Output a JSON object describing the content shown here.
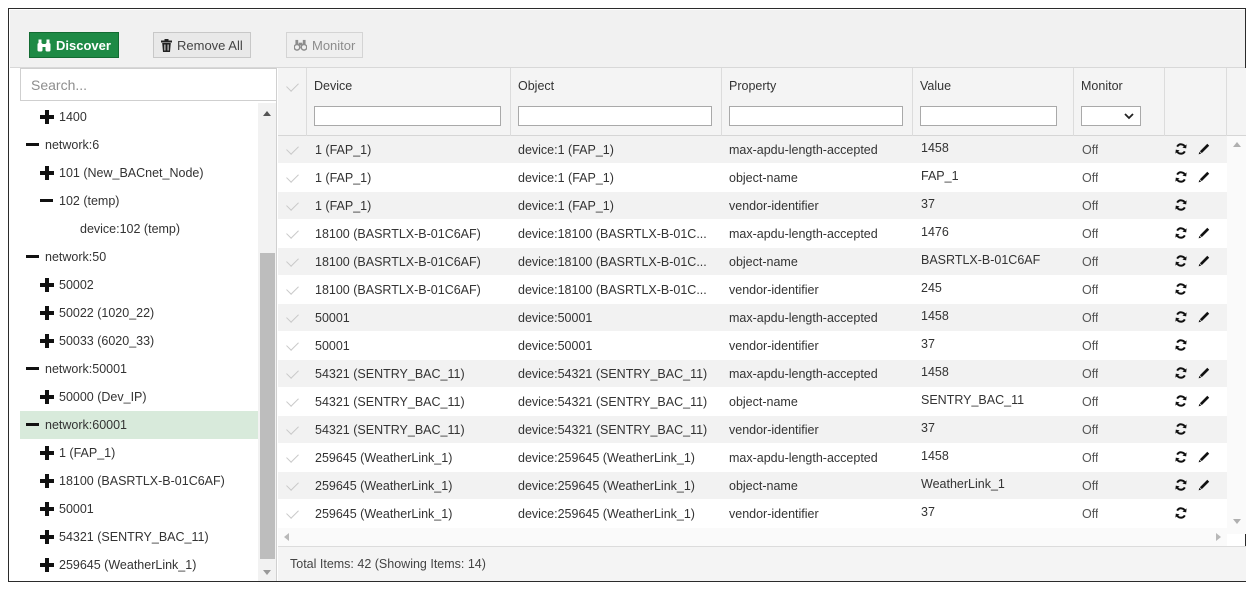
{
  "toolbar": {
    "discover_label": "Discover",
    "remove_all_label": "Remove All",
    "monitor_label": "Monitor",
    "discover_color": "#1e8a45"
  },
  "tree": {
    "search_placeholder": "Search...",
    "items": [
      {
        "label": "1400",
        "icon": "plus",
        "indent": 1
      },
      {
        "label": "network:6",
        "icon": "minus",
        "indent": 0
      },
      {
        "label": "101 (New_BACnet_Node)",
        "icon": "plus",
        "indent": 1
      },
      {
        "label": "102 (temp)",
        "icon": "minus",
        "indent": 1
      },
      {
        "label": "device:102 (temp)",
        "icon": "none",
        "indent": 2
      },
      {
        "label": "network:50",
        "icon": "minus",
        "indent": 0
      },
      {
        "label": "50002",
        "icon": "plus",
        "indent": 1
      },
      {
        "label": "50022 (1020_22)",
        "icon": "plus",
        "indent": 1
      },
      {
        "label": "50033 (6020_33)",
        "icon": "plus",
        "indent": 1
      },
      {
        "label": "network:50001",
        "icon": "minus",
        "indent": 0
      },
      {
        "label": "50000 (Dev_IP)",
        "icon": "plus",
        "indent": 1
      },
      {
        "label": "network:60001",
        "icon": "minus",
        "indent": 0,
        "selected": true
      },
      {
        "label": "1 (FAP_1)",
        "icon": "plus",
        "indent": 1
      },
      {
        "label": "18100 (BASRTLX-B-01C6AF)",
        "icon": "plus",
        "indent": 1
      },
      {
        "label": "50001",
        "icon": "plus",
        "indent": 1
      },
      {
        "label": "54321 (SENTRY_BAC_11)",
        "icon": "plus",
        "indent": 1
      },
      {
        "label": "259645 (WeatherLink_1)",
        "icon": "plus",
        "indent": 1
      }
    ]
  },
  "grid": {
    "columns": {
      "device": "Device",
      "object": "Object",
      "property": "Property",
      "value": "Value",
      "monitor": "Monitor"
    },
    "rows": [
      {
        "device": "1 (FAP_1)",
        "object": "device:1 (FAP_1)",
        "property": "max-apdu-length-accepted",
        "value": "1458",
        "monitor": "Off",
        "editable": true
      },
      {
        "device": "1 (FAP_1)",
        "object": "device:1 (FAP_1)",
        "property": "object-name",
        "value": "FAP_1",
        "monitor": "Off",
        "editable": true
      },
      {
        "device": "1 (FAP_1)",
        "object": "device:1 (FAP_1)",
        "property": "vendor-identifier",
        "value": "37",
        "monitor": "Off",
        "editable": false
      },
      {
        "device": "18100 (BASRTLX-B-01C6AF)",
        "object": "device:18100 (BASRTLX-B-01C...",
        "property": "max-apdu-length-accepted",
        "value": "1476",
        "monitor": "Off",
        "editable": true
      },
      {
        "device": "18100 (BASRTLX-B-01C6AF)",
        "object": "device:18100 (BASRTLX-B-01C...",
        "property": "object-name",
        "value": "BASRTLX-B-01C6AF",
        "monitor": "Off",
        "editable": true
      },
      {
        "device": "18100 (BASRTLX-B-01C6AF)",
        "object": "device:18100 (BASRTLX-B-01C...",
        "property": "vendor-identifier",
        "value": "245",
        "monitor": "Off",
        "editable": false
      },
      {
        "device": "50001",
        "object": "device:50001",
        "property": "max-apdu-length-accepted",
        "value": "1458",
        "monitor": "Off",
        "editable": true
      },
      {
        "device": "50001",
        "object": "device:50001",
        "property": "vendor-identifier",
        "value": "37",
        "monitor": "Off",
        "editable": false
      },
      {
        "device": "54321 (SENTRY_BAC_11)",
        "object": "device:54321 (SENTRY_BAC_11)",
        "property": "max-apdu-length-accepted",
        "value": "1458",
        "monitor": "Off",
        "editable": true
      },
      {
        "device": "54321 (SENTRY_BAC_11)",
        "object": "device:54321 (SENTRY_BAC_11)",
        "property": "object-name",
        "value": "SENTRY_BAC_11",
        "monitor": "Off",
        "editable": true
      },
      {
        "device": "54321 (SENTRY_BAC_11)",
        "object": "device:54321 (SENTRY_BAC_11)",
        "property": "vendor-identifier",
        "value": "37",
        "monitor": "Off",
        "editable": false
      },
      {
        "device": "259645 (WeatherLink_1)",
        "object": "device:259645 (WeatherLink_1)",
        "property": "max-apdu-length-accepted",
        "value": "1458",
        "monitor": "Off",
        "editable": true
      },
      {
        "device": "259645 (WeatherLink_1)",
        "object": "device:259645 (WeatherLink_1)",
        "property": "object-name",
        "value": "WeatherLink_1",
        "monitor": "Off",
        "editable": true
      },
      {
        "device": "259645 (WeatherLink_1)",
        "object": "device:259645 (WeatherLink_1)",
        "property": "vendor-identifier",
        "value": "37",
        "monitor": "Off",
        "editable": false
      }
    ]
  },
  "footer": {
    "status": "Total Items: 42 (Showing Items: 14)"
  }
}
